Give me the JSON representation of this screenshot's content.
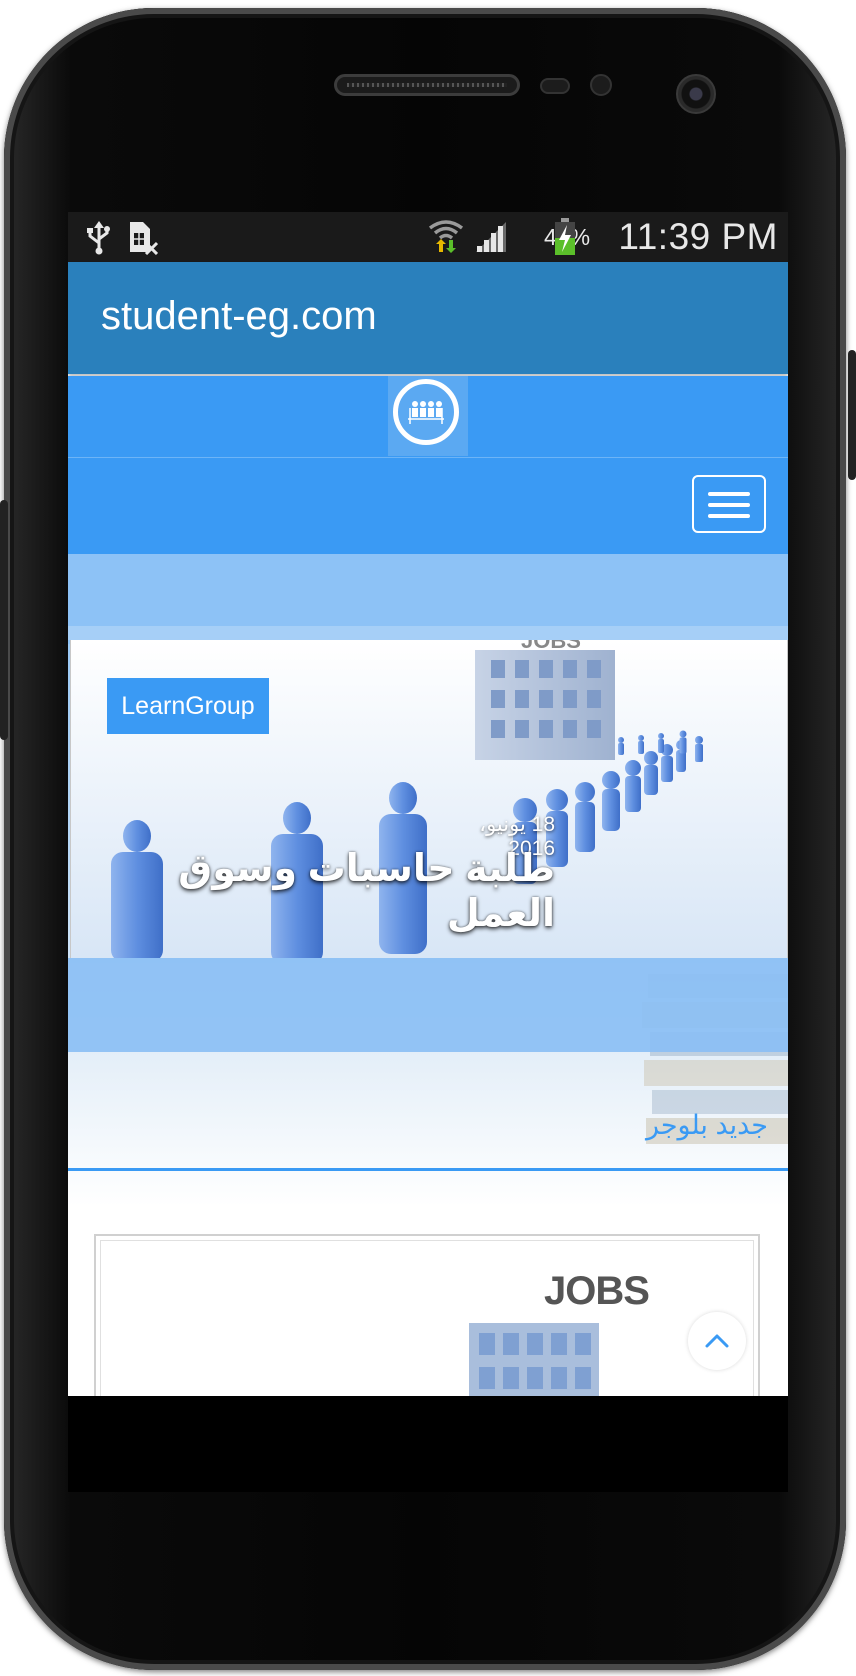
{
  "status_bar": {
    "battery_percent": "42%",
    "time": "11:39 PM",
    "icons": [
      "usb-icon",
      "no-sim-icon",
      "wifi-icon",
      "signal-icon",
      "battery-charging-icon"
    ]
  },
  "app_bar": {
    "title": "student-eg.com"
  },
  "header": {
    "logo": "learn-group-logo",
    "menu_icon": "hamburger-menu-icon"
  },
  "featured_post": {
    "category": "LearnGroup",
    "date": "18 يونيو، 2016",
    "title": "طلبة حاسبات وسوق العمل"
  },
  "section": {
    "heading": "جديد بلوجر"
  },
  "post_card": {
    "sign_text": "JOBS"
  },
  "scroll_top": {
    "icon": "chevron-up-icon"
  },
  "colors": {
    "app_bar": "#2a80bc",
    "brand_blue": "#3a9af4",
    "band_light_blue": "#8dc2f6",
    "status_bar": "#1a1a1a"
  }
}
